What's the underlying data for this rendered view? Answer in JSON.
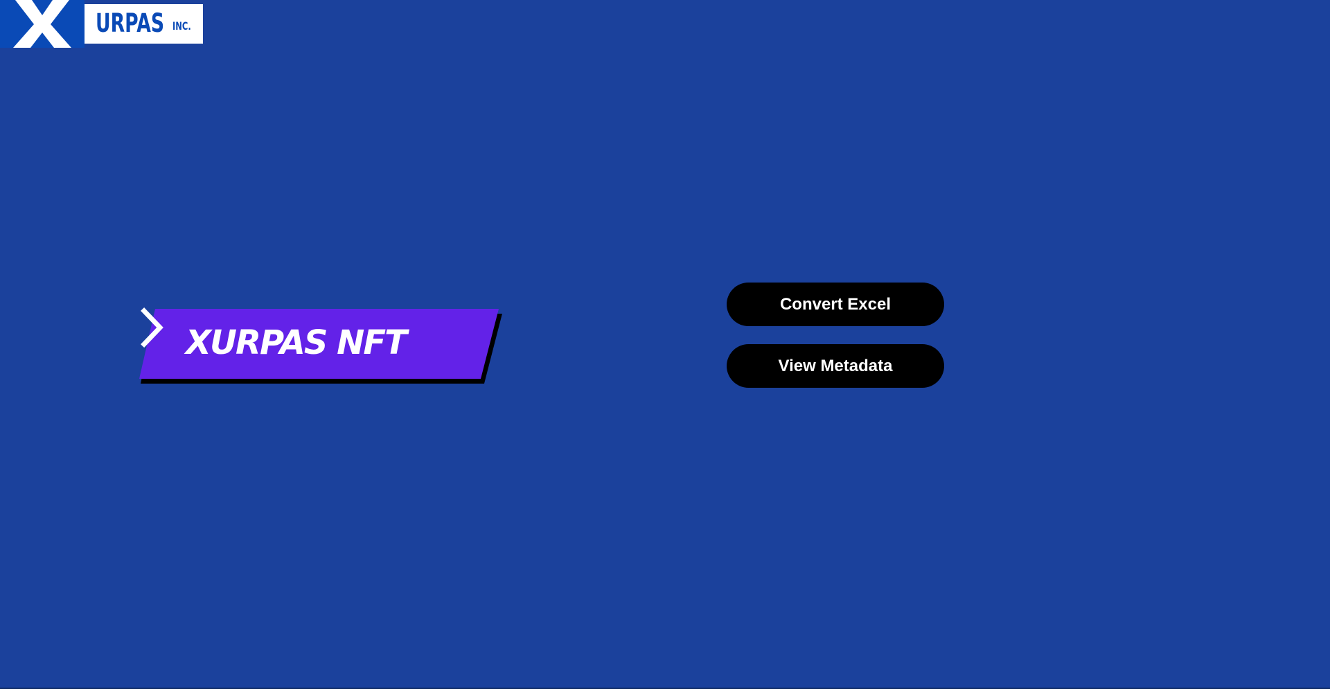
{
  "colors": {
    "background": "#1b419c",
    "logo_blue": "#0a4ab6",
    "hero_purple": "#6322e8",
    "hero_shadow": "#000000",
    "button_bg": "#000000",
    "button_text": "#ffffff"
  },
  "logo": {
    "word": "URPAS",
    "suffix": "INC.",
    "icon": "x-letter-icon"
  },
  "hero": {
    "label": "XURPAS NFT",
    "icon": "chevron-right-icon"
  },
  "actions": {
    "convert_label": "Convert Excel",
    "view_label": "View Metadata"
  }
}
